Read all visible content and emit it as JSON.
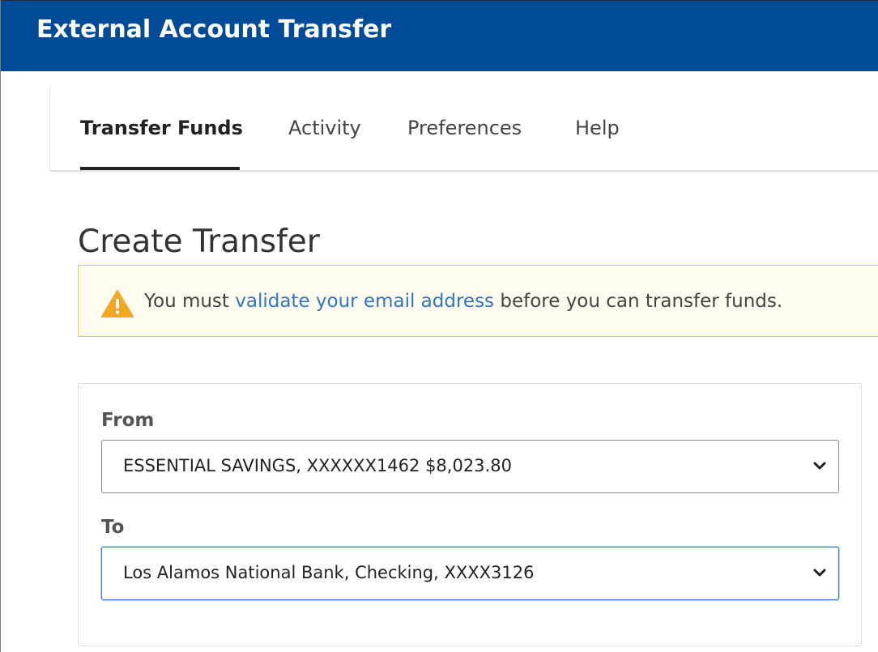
{
  "header": {
    "title": "External Account Transfer",
    "background_color": "#004b98"
  },
  "nav": {
    "tabs": [
      {
        "label": "Transfer Funds",
        "active": true
      },
      {
        "label": "Activity",
        "active": false
      },
      {
        "label": "Preferences",
        "active": false
      },
      {
        "label": "Help",
        "active": false
      }
    ]
  },
  "page": {
    "title": "Create Transfer"
  },
  "alert": {
    "icon": "warning-icon",
    "text_before": "You must ",
    "link_text": "validate your email address",
    "text_after": " before you can transfer funds.",
    "border_color": "#f5c242",
    "link_color": "#2f75c0"
  },
  "form": {
    "from": {
      "label": "From",
      "selected": "ESSENTIAL SAVINGS, XXXXXX1462 $8,023.80"
    },
    "to": {
      "label": "To",
      "selected": "Los Alamos National Bank, Checking, XXXX3126"
    }
  }
}
